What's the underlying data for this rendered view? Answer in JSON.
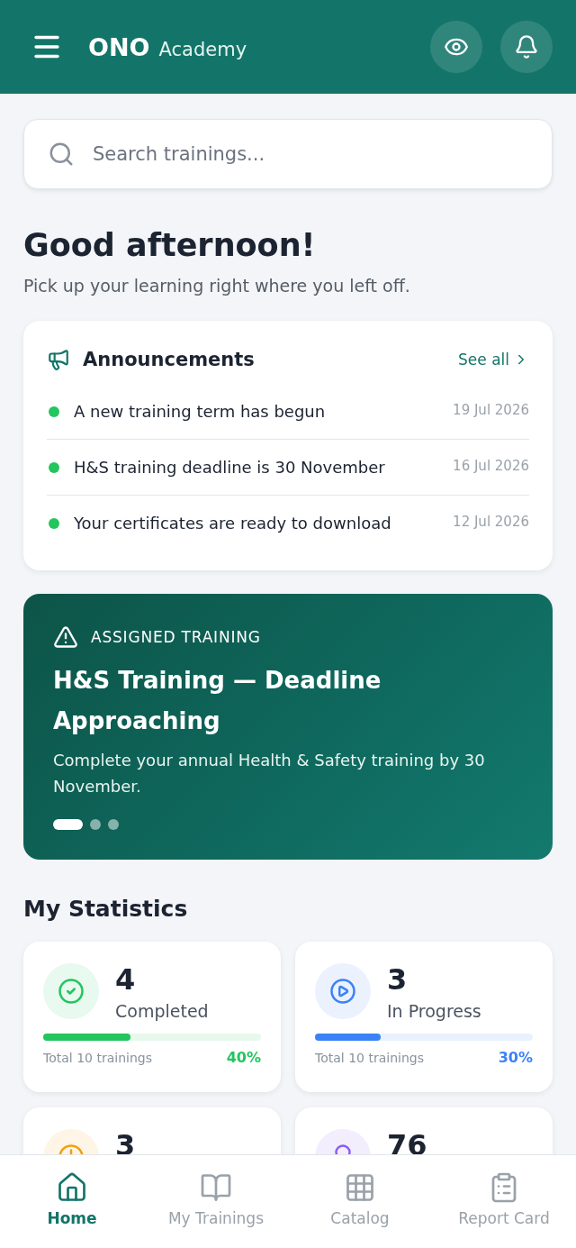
{
  "header": {
    "brand_bold": "ONO",
    "brand_light": "Academy"
  },
  "search": {
    "placeholder": "Search trainings..."
  },
  "greeting": {
    "title": "Good afternoon!",
    "subtitle": "Pick up your learning right where you left off."
  },
  "announcements": {
    "title": "Announcements",
    "see_all": "See all",
    "items": [
      {
        "text": "A new training term has begun",
        "date": "19 Jul 2026"
      },
      {
        "text": "H&S training deadline is 30 November",
        "date": "16 Jul 2026"
      },
      {
        "text": "Your certificates are ready to download",
        "date": "12 Jul 2026"
      }
    ]
  },
  "banner": {
    "tag": "ASSIGNED TRAINING",
    "title": "H&S Training — Deadline Approaching",
    "text": "Complete your annual Health & Safety training by 30 November.",
    "dots": [
      {
        "selected": true
      },
      {
        "selected": false
      },
      {
        "selected": false
      }
    ]
  },
  "statistics": {
    "title": "My Statistics",
    "cards": [
      {
        "kind": "completed",
        "color": "#22c55e",
        "value": "4",
        "label": "Completed",
        "total": "Total 10 trainings",
        "percent": "40%",
        "level": 0.4
      },
      {
        "kind": "progress",
        "color": "#3b82f6",
        "value": "3",
        "label": "In Progress",
        "total": "Total 10 trainings",
        "percent": "30%",
        "level": 0.3
      },
      {
        "kind": "pending",
        "color": "#f59e0b",
        "value": "3"
      },
      {
        "kind": "score",
        "color": "#8b5cf6",
        "value": "76"
      }
    ]
  },
  "bottom_nav": [
    {
      "kind": "home",
      "label": "Home",
      "selected": true
    },
    {
      "kind": "book",
      "label": "My Trainings",
      "selected": false
    },
    {
      "kind": "grid",
      "label": "Catalog",
      "selected": false
    },
    {
      "kind": "clipboard",
      "label": "Report Card",
      "selected": false
    }
  ]
}
